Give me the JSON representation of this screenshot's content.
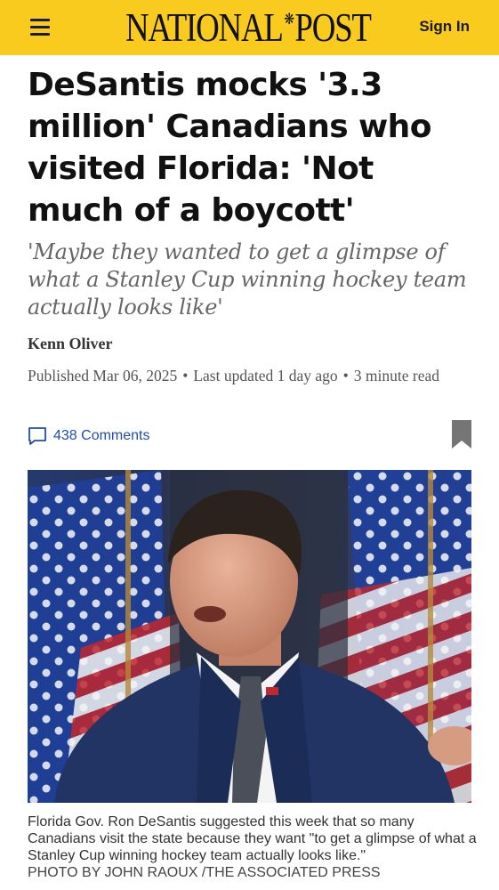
{
  "header": {
    "logo_left": "NATIONAL",
    "logo_right": "POST",
    "sign_in": "Sign In",
    "brand_color": "#f9cb1f",
    "menu_icon": "hamburger-menu-icon",
    "logo_icon": "maple-leaf-icon"
  },
  "article": {
    "headline": "DeSantis mocks '3.3 million' Canadians who visited Florida: 'Not much of a boycott'",
    "subhead": "'Maybe they wanted to get a glimpse of what a Stanley Cup winning hockey team actually looks like'",
    "author": "Kenn Oliver",
    "published": "Published Mar 06, 2025",
    "updated": "Last updated 1 day ago",
    "read_time": "3 minute read",
    "separator": "•",
    "comments": "438 Comments",
    "comments_icon": "speech-bubble-icon",
    "bookmark_icon": "bookmark-icon"
  },
  "photo": {
    "caption": "Florida Gov. Ron DeSantis suggested this week that so many Canadians visit the state because they want \"to get a glimpse of what a Stanley Cup winning hockey team actually looks like.\"",
    "credit": "PHOTO BY JOHN RAOUX /THE ASSOCIATED PRESS"
  }
}
